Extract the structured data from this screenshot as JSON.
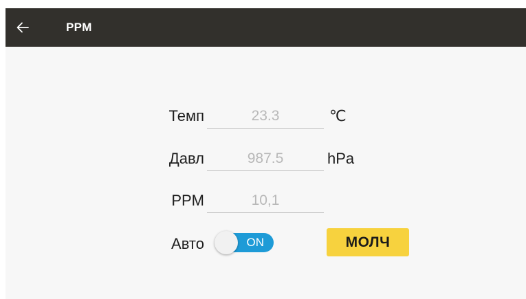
{
  "appbar": {
    "back_icon": "arrow-left-icon",
    "title": "PPM"
  },
  "form": {
    "temp": {
      "label": "Темп",
      "value": "23.3",
      "unit": "℃"
    },
    "pressure": {
      "label": "Давл",
      "value": "987.5",
      "unit": "hPa"
    },
    "ppm": {
      "label": "PPM",
      "value": "10,1"
    },
    "auto": {
      "label": "Авто",
      "toggle_text": "ON",
      "toggle_on": true
    }
  },
  "mute_button": {
    "label": "МОЛЧ"
  },
  "colors": {
    "appbar": "#32302c",
    "background": "#f7f7f7",
    "toggle_on": "#1e9bd7",
    "mute_button": "#f7d23e"
  }
}
